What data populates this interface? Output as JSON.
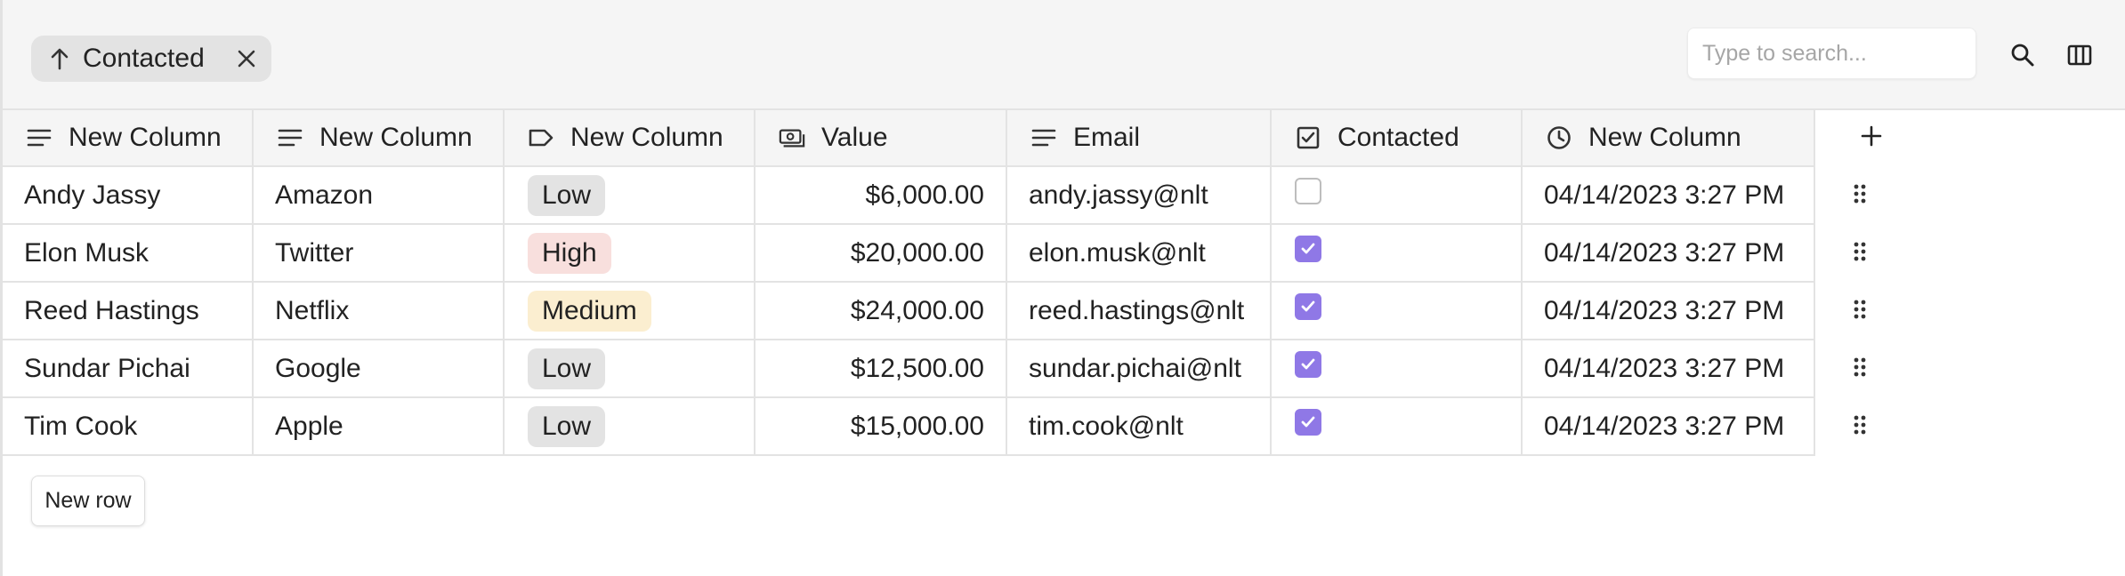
{
  "toolbar": {
    "filter_chip": {
      "label": "Contacted",
      "direction_icon": "arrow-up-icon",
      "remove_icon": "close-icon"
    },
    "search": {
      "placeholder": "Type to search...",
      "value": ""
    },
    "search_icon": "search-icon",
    "columns_icon": "columns-icon"
  },
  "table": {
    "headers": [
      {
        "label": "New Column",
        "icon": "text-lines-icon"
      },
      {
        "label": "New Column",
        "icon": "text-lines-icon"
      },
      {
        "label": "New Column",
        "icon": "tag-icon"
      },
      {
        "label": "Value",
        "icon": "money-icon"
      },
      {
        "label": "Email",
        "icon": "text-lines-icon"
      },
      {
        "label": "Contacted",
        "icon": "checkbox-icon"
      },
      {
        "label": "New Column",
        "icon": "clock-icon"
      }
    ],
    "add_column_icon": "plus-icon",
    "rows": [
      {
        "name": "Andy Jassy",
        "company": "Amazon",
        "priority": "Low",
        "value": "$6,000.00",
        "email": "andy.jassy@nlt",
        "contacted": false,
        "datetime": "04/14/2023 3:27 PM"
      },
      {
        "name": "Elon Musk",
        "company": "Twitter",
        "priority": "High",
        "value": "$20,000.00",
        "email": "elon.musk@nlt",
        "contacted": true,
        "datetime": "04/14/2023 3:27 PM"
      },
      {
        "name": "Reed Hastings",
        "company": "Netflix",
        "priority": "Medium",
        "value": "$24,000.00",
        "email": "reed.hastings@nlt",
        "contacted": true,
        "datetime": "04/14/2023 3:27 PM"
      },
      {
        "name": "Sundar Pichai",
        "company": "Google",
        "priority": "Low",
        "value": "$12,500.00",
        "email": "sundar.pichai@nlt",
        "contacted": true,
        "datetime": "04/14/2023 3:27 PM"
      },
      {
        "name": "Tim Cook",
        "company": "Apple",
        "priority": "Low",
        "value": "$15,000.00",
        "email": "tim.cook@nlt",
        "contacted": true,
        "datetime": "04/14/2023 3:27 PM"
      }
    ],
    "row_menu_icon": "drag-handle-icon"
  },
  "colors": {
    "tag_low": "#e3e3e3",
    "tag_high": "#f8dfdd",
    "tag_medium": "#fbeed0",
    "checkbox_checked": "#8f78e6"
  },
  "footer": {
    "new_row_label": "New row"
  }
}
